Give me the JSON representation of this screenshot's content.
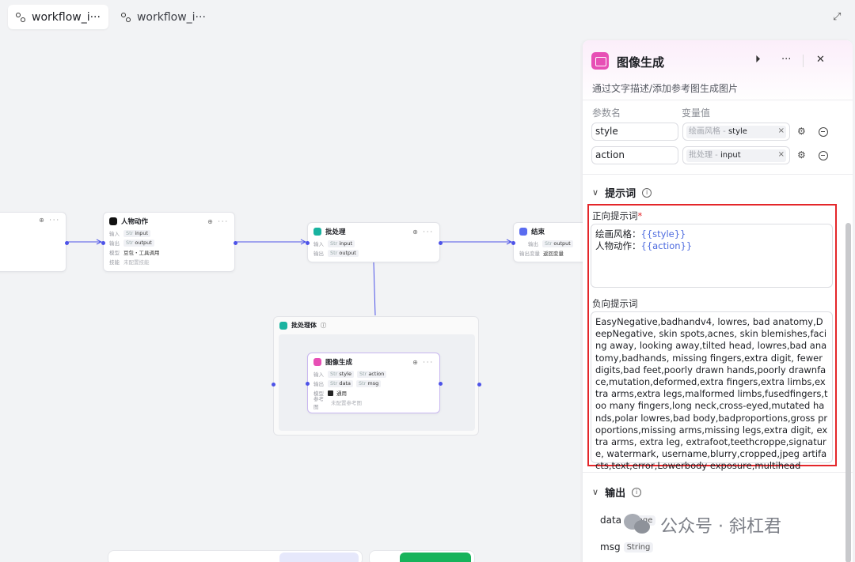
{
  "tabs": [
    {
      "label": "workflow_i···",
      "active": true
    },
    {
      "label": "workflow_i···",
      "active": false
    }
  ],
  "canvas": {
    "node_menu": "⊕ ···",
    "nodes": {
      "character": {
        "title": "人物动作",
        "rows": [
          {
            "label": "输入",
            "type": "Str",
            "value": "input"
          },
          {
            "label": "输出",
            "type": "Str",
            "value": "output"
          },
          {
            "label": "模型",
            "value": "豆包・工具调用"
          },
          {
            "label": "技能",
            "value": "未配置技能"
          }
        ]
      },
      "batch": {
        "title": "批处理",
        "rows": [
          {
            "label": "输入",
            "type": "Str",
            "value": "input"
          },
          {
            "label": "输出",
            "type": "Str",
            "value": "output"
          }
        ]
      },
      "end": {
        "title": "结束",
        "rows": [
          {
            "label": "输出",
            "type": "Str",
            "value": "output"
          },
          {
            "label": "输出变量",
            "value": "返回变量"
          }
        ]
      },
      "batch_body": {
        "title": "批处理体"
      },
      "image_gen": {
        "title": "图像生成",
        "rows": [
          {
            "label": "输入",
            "items": [
              {
                "type": "Str",
                "value": "style"
              },
              {
                "type": "Str",
                "value": "action"
              }
            ]
          },
          {
            "label": "输出",
            "items": [
              {
                "type": "Str",
                "value": "data"
              },
              {
                "type": "Str",
                "value": "msg"
              }
            ]
          },
          {
            "label": "模型",
            "value": "通用"
          },
          {
            "label": "参考图",
            "value": "未配置参考图"
          }
        ]
      }
    }
  },
  "panel": {
    "title": "图像生成",
    "description": "通过文字描述/添加参考图生成图片",
    "col_name": "参数名",
    "col_value": "变量值",
    "params": [
      {
        "name": "style",
        "source": "绘画风格",
        "variable": "style"
      },
      {
        "name": "action",
        "source": "批处理",
        "variable": "input"
      }
    ],
    "prompt_section": "提示词",
    "positive_label": "正向提示词",
    "positive_lines": [
      {
        "prefix": "绘画风格：",
        "var": "{{style}}"
      },
      {
        "prefix": "人物动作：",
        "var": "{{action}}"
      }
    ],
    "negative_label": "负向提示词",
    "negative_text": "EasyNegative,badhandv4, lowres, bad anatomy,DeepNegative, skin spots,acnes, skin blemishes,facing away, looking away,tilted head, lowres,bad anatomy,badhands, missing fingers,extra digit, fewer digits,bad feet,poorly drawn hands,poorly drawnface,mutation,deformed,extra fingers,extra limbs,extra arms,extra legs,malformed limbs,fusedfingers,too many fingers,long neck,cross-eyed,mutated hands,polar lowres,bad body,badproportions,gross proportions,missing arms,missing legs,extra digit, extra arms, extra leg, extrafoot,teethcroppe,signature, watermark, username,blurry,cropped,jpeg artifacts,text,error,Lowerbody exposure,multihead",
    "output_section": "输出",
    "outputs": [
      {
        "name": "data",
        "type": "Image"
      },
      {
        "name": "msg",
        "type": "String"
      }
    ]
  },
  "watermark": "公众号 · 斜杠君",
  "colors": {
    "accent": "#4d53e8",
    "highlight": "#e4262a",
    "run": "#17b35b",
    "image_node": "#e74fb5"
  }
}
